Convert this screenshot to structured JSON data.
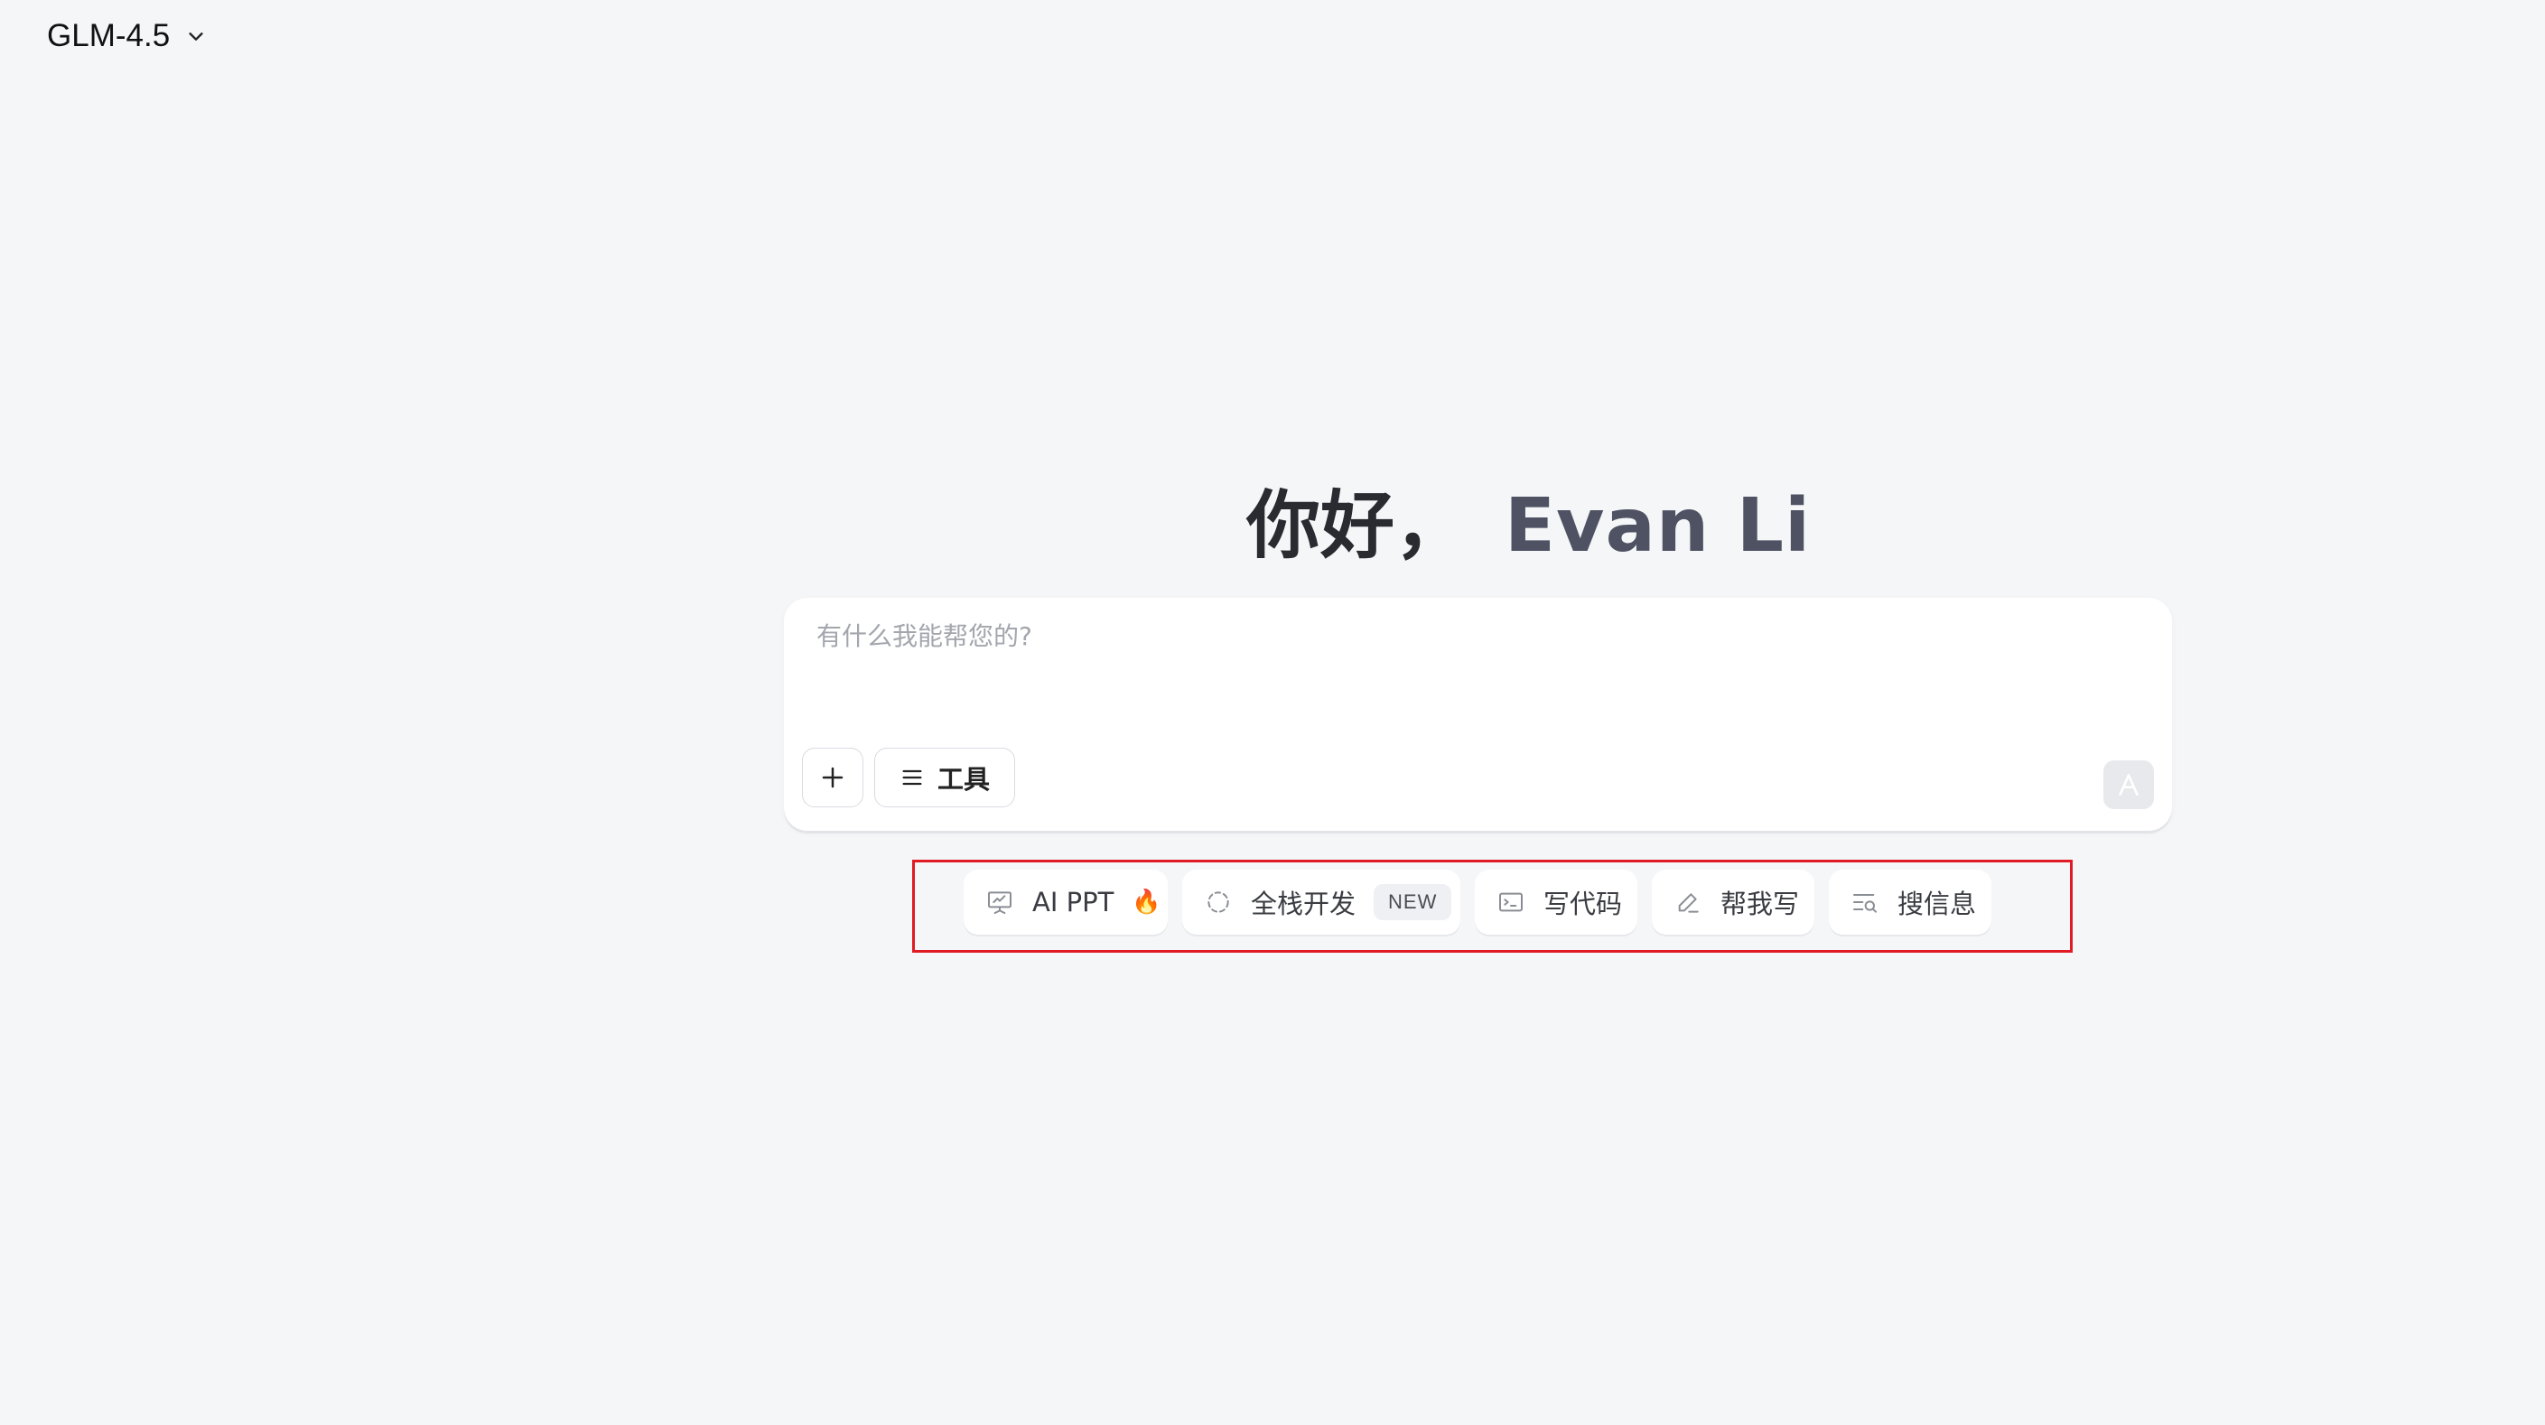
{
  "header": {
    "model_name": "GLM-4.5",
    "dropdown_icon": "chevron-down-icon"
  },
  "greeting": {
    "hello": "你好，",
    "name": "Evan Li"
  },
  "composer": {
    "placeholder": "有什么我能帮您的?",
    "add_icon": "plus-icon",
    "tools_label": "工具",
    "tools_icon": "menu-icon",
    "send_icon": "send-icon"
  },
  "shortcuts": [
    {
      "label": "AI PPT",
      "icon": "presentation-icon",
      "extra": "🔥"
    },
    {
      "label": "全栈开发",
      "icon": "dashed-circle-icon",
      "badge": "NEW"
    },
    {
      "label": "写代码",
      "icon": "terminal-icon"
    },
    {
      "label": "帮我写",
      "icon": "pen-icon"
    },
    {
      "label": "搜信息",
      "icon": "search-list-icon"
    }
  ],
  "colors": {
    "background": "#f5f6f8",
    "highlight_frame": "#e01b24",
    "fire": "#ff5a1f"
  }
}
